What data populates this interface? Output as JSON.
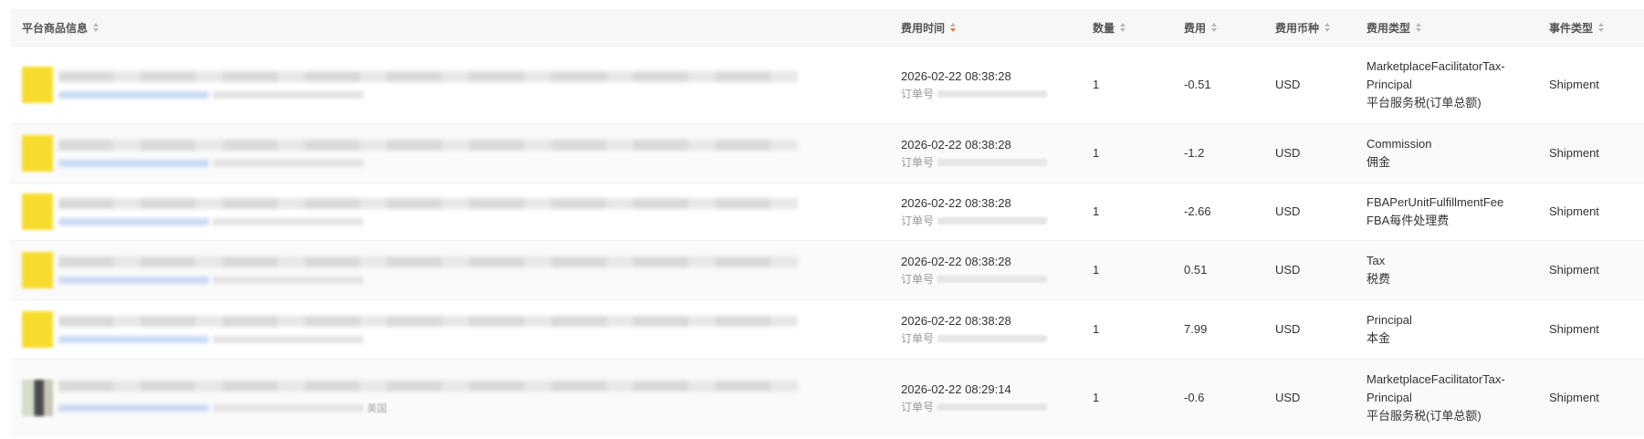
{
  "table": {
    "headers": [
      "平台商品信息",
      "费用时间",
      "数量",
      "费用",
      "费用币种",
      "费用类型",
      "事件类型"
    ],
    "order_label": "订单号",
    "rows": [
      {
        "time": "2026-02-22 08:38:28",
        "qty": "1",
        "fee": "-0.51",
        "currency": "USD",
        "fee_type_en": "MarketplaceFacilitatorTax-",
        "fee_type_en2": "Principal",
        "fee_type_cn": "平台服务税(订单总额)",
        "event": "Shipment"
      },
      {
        "time": "2026-02-22 08:38:28",
        "qty": "1",
        "fee": "-1.2",
        "currency": "USD",
        "fee_type_en": "Commission",
        "fee_type_en2": "",
        "fee_type_cn": "佣金",
        "event": "Shipment"
      },
      {
        "time": "2026-02-22 08:38:28",
        "qty": "1",
        "fee": "-2.66",
        "currency": "USD",
        "fee_type_en": "FBAPerUnitFulfillmentFee",
        "fee_type_en2": "",
        "fee_type_cn": "FBA每件处理费",
        "event": "Shipment"
      },
      {
        "time": "2026-02-22 08:38:28",
        "qty": "1",
        "fee": "0.51",
        "currency": "USD",
        "fee_type_en": "Tax",
        "fee_type_en2": "",
        "fee_type_cn": "税费",
        "event": "Shipment"
      },
      {
        "time": "2026-02-22 08:38:28",
        "qty": "1",
        "fee": "7.99",
        "currency": "USD",
        "fee_type_en": "Principal",
        "fee_type_en2": "",
        "fee_type_cn": "本金",
        "event": "Shipment"
      },
      {
        "time": "2026-02-22 08:29:14",
        "qty": "1",
        "fee": "-0.6",
        "currency": "USD",
        "fee_type_en": "MarketplaceFacilitatorTax-",
        "fee_type_en2": "Principal",
        "fee_type_cn": "平台服务税(订单总额)",
        "event": "Shipment",
        "region": "美国"
      }
    ]
  },
  "colors": {
    "accent_sort": "#f0782c",
    "header_bg": "#f7f7f7"
  }
}
